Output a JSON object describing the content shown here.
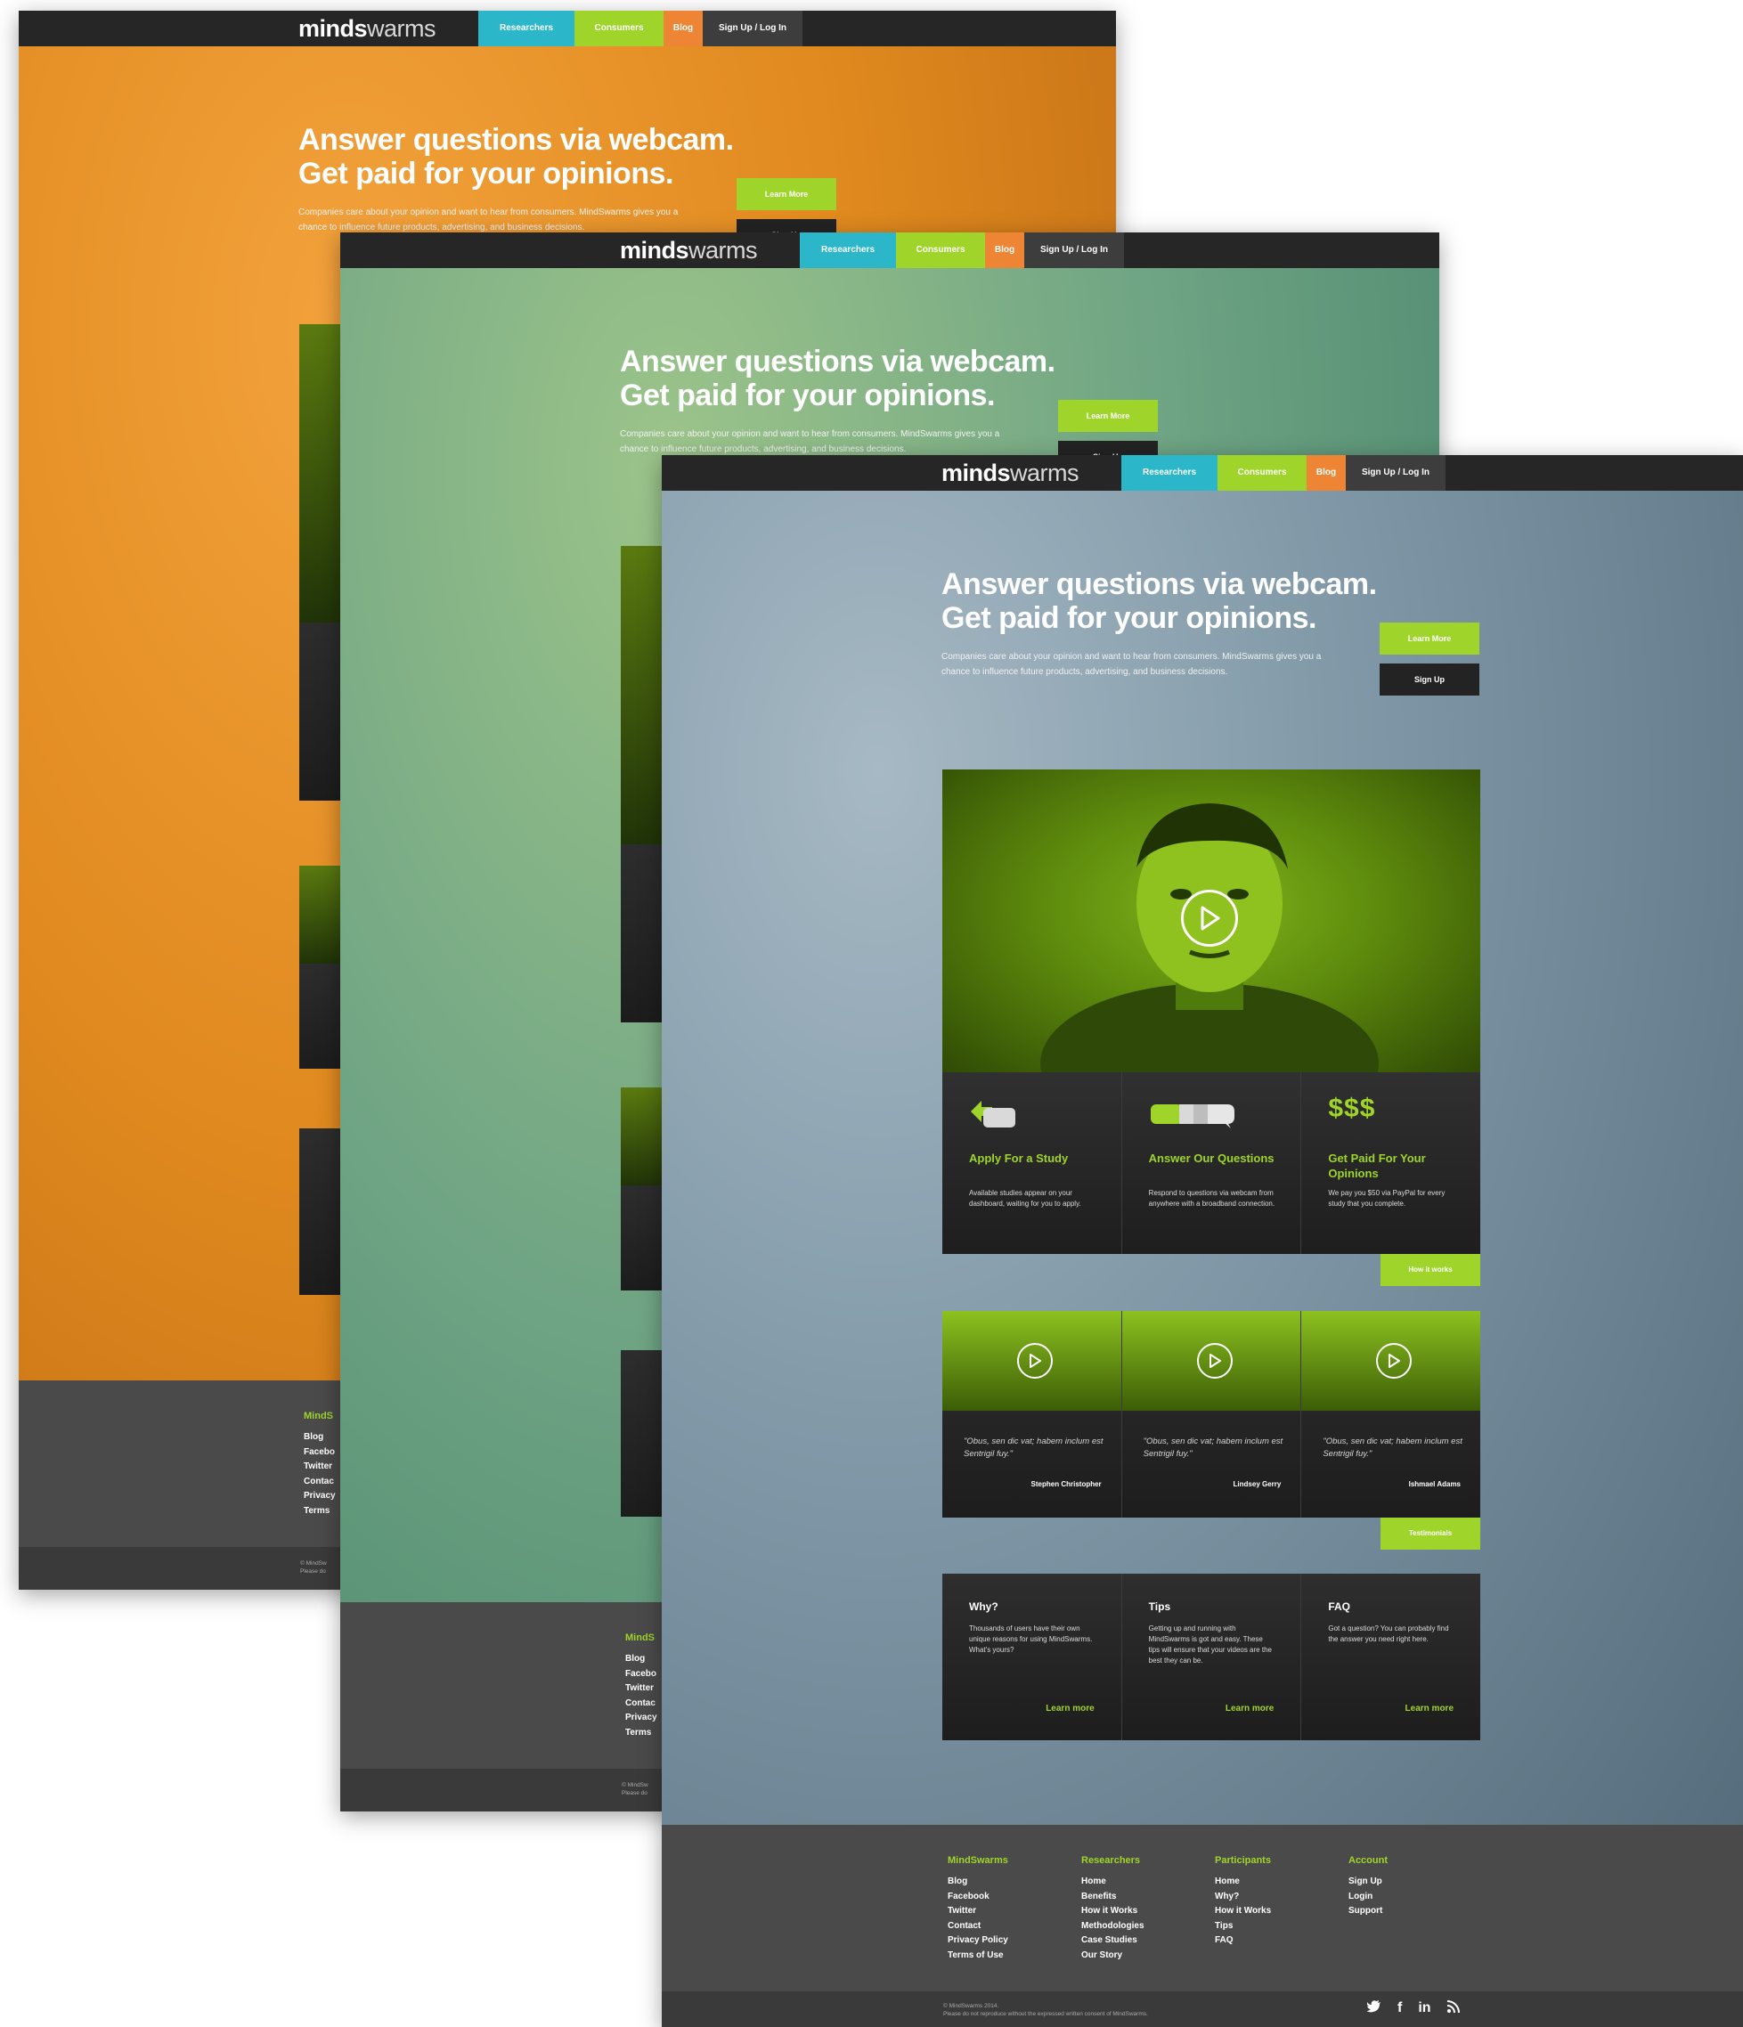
{
  "nav": {
    "logo_bold": "minds",
    "logo_light": "warms",
    "researchers": "Researchers",
    "consumers": "Consumers",
    "blog": "Blog",
    "signup_login": "Sign Up / Log In"
  },
  "hero": {
    "line1": "Answer questions via webcam.",
    "line2": "Get paid for your opinions.",
    "text": "Companies care about your opinion and want to hear from consumers. MindSwarms gives you a chance to influence future products, advertising, and business decisions.",
    "learn_more": "Learn More",
    "sign_up": "Sign Up"
  },
  "steps": [
    {
      "title": "Apply For a Study",
      "text": "Available studies appear on your dashboard, waiting for you to apply."
    },
    {
      "title": "Answer Our Questions",
      "text": "Respond to questions via webcam from anywhere with a broadband connection."
    },
    {
      "title": "Get Paid For Your Opinions",
      "text": "We pay you $50 via PayPal for every study that you complete."
    }
  ],
  "step3_symbol": "$$$",
  "how_it_works": "How it works",
  "testimonials": [
    {
      "quote": "\"Obus, sen dic vat; habem inclum est Sentrigil fuy.\"",
      "name": "Stephen Christopher"
    },
    {
      "quote": "\"Obus, sen dic vat; habem inclum est Sentrigil fuy.\"",
      "name": "Lindsey Gerry"
    },
    {
      "quote": "\"Obus, sen dic vat; habem inclum est Sentrigil fuy.\"",
      "name": "Ishmael Adams"
    }
  ],
  "testimonials_button": "Testimonials",
  "info": [
    {
      "title": "Why?",
      "text": "Thousands of users have their own unique reasons for using MindSwarms. What's yours?",
      "link": "Learn more"
    },
    {
      "title": "Tips",
      "text": "Getting up and running with MindSwarms is got and easy. These tips will ensure that your videos are the best they can be.",
      "link": "Learn more"
    },
    {
      "title": "FAQ",
      "text": "Got a question? You can probably find the answer you need right here.",
      "link": "Learn more"
    }
  ],
  "footer": {
    "columns": [
      {
        "title": "MindSwarms",
        "links": [
          "Blog",
          "Facebook",
          "Twitter",
          "Contact",
          "Privacy Policy",
          "Terms of Use"
        ]
      },
      {
        "title": "Researchers",
        "links": [
          "Home",
          "Benefits",
          "How it Works",
          "Methodologies",
          "Case Studies",
          "Our Story"
        ]
      },
      {
        "title": "Participants",
        "links": [
          "Home",
          "Why?",
          "How it Works",
          "Tips",
          "FAQ"
        ]
      },
      {
        "title": "Account",
        "links": [
          "Sign Up",
          "Login",
          "Support"
        ]
      }
    ],
    "copyright": "© MindSwarms 2014.",
    "notice": "Please do not reproduce without the expressed written consent of MindSwarms.",
    "back_title": "MindS",
    "back_links": [
      "Blog",
      "Facebo",
      "Twitter",
      "Contac",
      "Privacy",
      "Terms"
    ],
    "back_copy1": "© MindSw",
    "back_copy2": "Please do"
  },
  "social": {
    "twitter": "t",
    "facebook": "f",
    "linkedin": "in",
    "rss": "rss"
  },
  "colors": {
    "accent_green": "#9fd52a",
    "cyan": "#2bb7c9",
    "orange": "#ee8535",
    "dark": "#262626"
  }
}
